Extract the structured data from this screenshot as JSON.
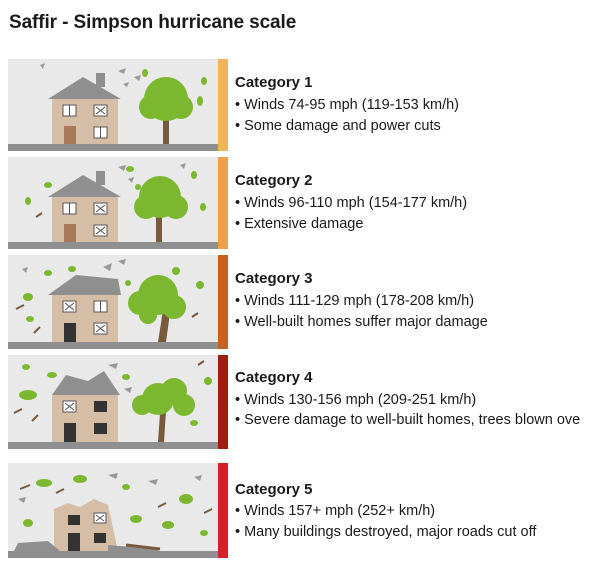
{
  "title": "Saffir - Simpson hurricane scale",
  "categories": [
    {
      "name": "Category 1",
      "bullets": [
        "• Winds 74-95 mph (119-153 km/h)",
        "• Some damage and power cuts"
      ],
      "color": "#f5b45a"
    },
    {
      "name": "Category 2",
      "bullets": [
        "• Winds 96-110 mph (154-177 km/h)",
        "• Extensive damage"
      ],
      "color": "#f0a04b"
    },
    {
      "name": "Category 3",
      "bullets": [
        "• Winds 111-129 mph (178-208 km/h)",
        "• Well-built homes suffer major damage"
      ],
      "color": "#c8601e"
    },
    {
      "name": "Category 4",
      "bullets": [
        "• Winds 130-156 mph (209-251 km/h)",
        "• Severe damage to well-built homes, trees blown ove"
      ],
      "color": "#a01c0c"
    },
    {
      "name": "Category 5",
      "bullets": [
        "• Winds 157+ mph (252+ km/h)",
        "• Many buildings destroyed, major roads cut off"
      ],
      "color": "#d61f26"
    }
  ]
}
